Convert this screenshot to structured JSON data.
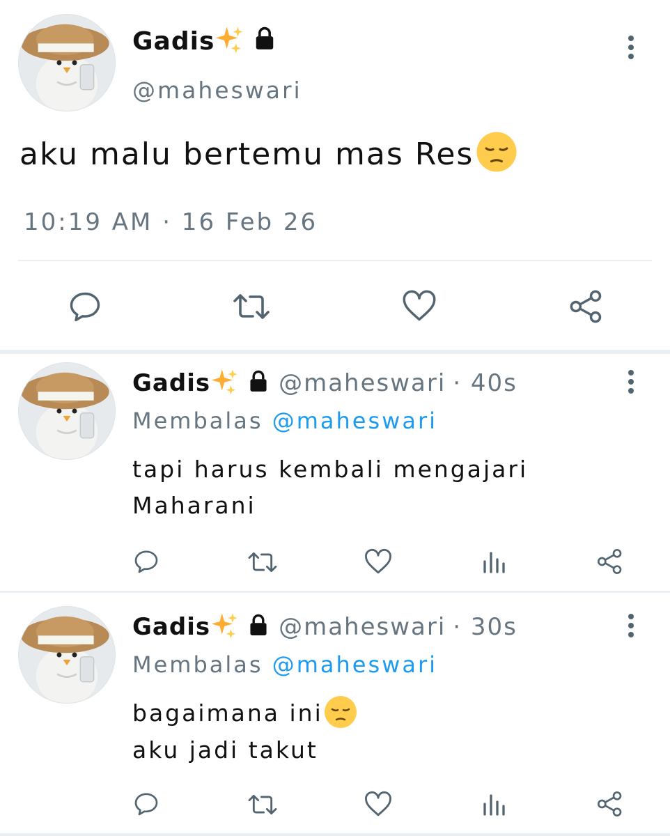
{
  "main_tweet": {
    "display_name": "Gadis",
    "name_emoji": "sparkles-emoji",
    "locked_icon": "lock-icon",
    "handle": "@maheswari",
    "text": "aku malu bertemu mas Res",
    "text_emoji": "pensive-face-emoji",
    "timestamp": "10:19 AM · 16 Feb 26",
    "actions": [
      "reply-icon",
      "retweet-icon",
      "like-icon",
      "share-icon"
    ]
  },
  "replies": [
    {
      "display_name": "Gadis",
      "handle": "@maheswari",
      "age": "· 40s",
      "replying_label": "Membalas",
      "replying_to": "@maheswari",
      "lines": [
        "tapi harus kembali mengajari",
        "Maharani"
      ],
      "actions": [
        "reply-icon",
        "retweet-icon",
        "like-icon",
        "analytics-icon",
        "share-icon"
      ]
    },
    {
      "display_name": "Gadis",
      "handle": "@maheswari",
      "age": "· 30s",
      "replying_label": "Membalas",
      "replying_to": "@maheswari",
      "lines": [
        "bagaimana ini",
        "aku jadi takut"
      ],
      "line_emoji": "pensive-face-emoji",
      "actions": [
        "reply-icon",
        "retweet-icon",
        "like-icon",
        "analytics-icon",
        "share-icon"
      ]
    }
  ],
  "colors": {
    "text": "#111111",
    "muted": "#66757f",
    "link": "#1d9bf0",
    "icon": "#536471",
    "divider": "#eceff1"
  }
}
